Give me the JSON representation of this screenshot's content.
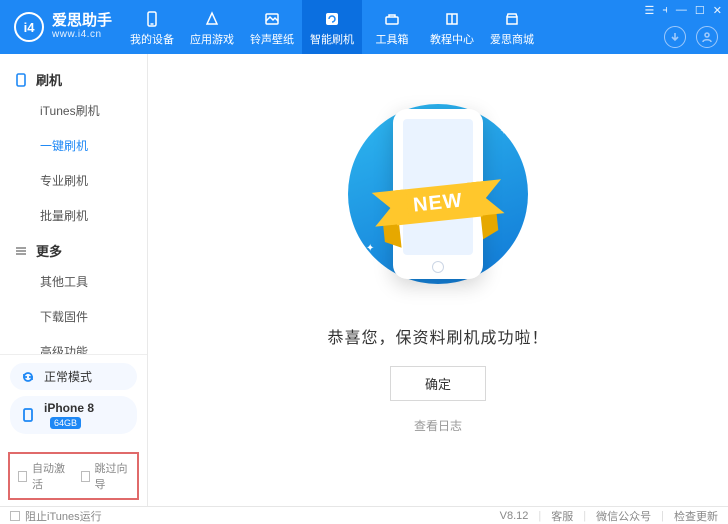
{
  "brand": {
    "logo_text": "i4",
    "title": "爱思助手",
    "sub": "www.i4.cn"
  },
  "nav": {
    "items": [
      {
        "label": "我的设备"
      },
      {
        "label": "应用游戏"
      },
      {
        "label": "铃声壁纸"
      },
      {
        "label": "智能刷机"
      },
      {
        "label": "工具箱"
      },
      {
        "label": "教程中心"
      },
      {
        "label": "爱思商城"
      }
    ],
    "active_index": 3
  },
  "sidebar": {
    "group1_title": "刷机",
    "group1_items": [
      "iTunes刷机",
      "一键刷机",
      "专业刷机",
      "批量刷机"
    ],
    "group1_active_index": 1,
    "group2_title": "更多",
    "group2_items": [
      "其他工具",
      "下载固件",
      "高级功能"
    ],
    "mode_label": "正常模式",
    "device_name": "iPhone 8",
    "device_size": "64GB",
    "checkbox1": "自动激活",
    "checkbox2": "跳过向导"
  },
  "main": {
    "ribbon": "NEW",
    "success": "恭喜您，保资料刷机成功啦！",
    "ok": "确定",
    "log": "查看日志"
  },
  "status": {
    "block_itunes": "阻止iTunes运行",
    "version": "V8.12",
    "svc": "客服",
    "wechat": "微信公众号",
    "update": "检查更新"
  }
}
